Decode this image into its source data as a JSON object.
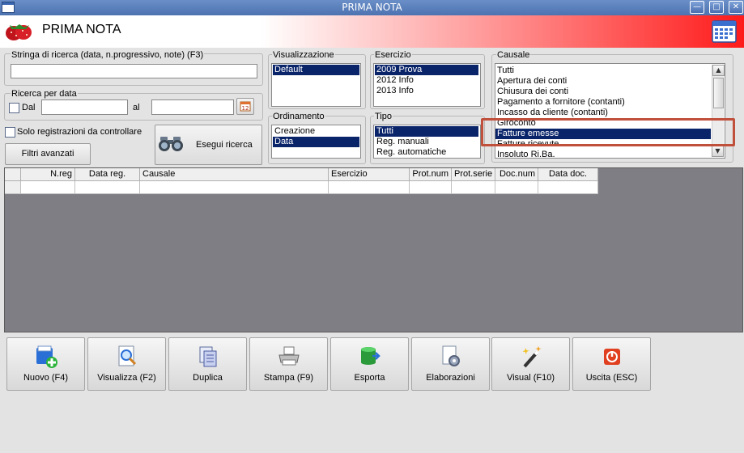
{
  "window": {
    "title": "PRIMA NOTA"
  },
  "header": {
    "title": "PRIMA NOTA"
  },
  "search": {
    "label": "Stringa di ricerca (data, n.progressivo, note) (F3)",
    "value": ""
  },
  "date_search": {
    "label": "Ricerca per data",
    "from_label": "Dal",
    "to_label": "al",
    "from_value": "",
    "to_value": ""
  },
  "options": {
    "only_to_check_label": "Solo registrazioni da controllare",
    "advanced_filters_label": "Filtri avanzati",
    "run_search_label": "Esegui ricerca"
  },
  "visualizzazione": {
    "label": "Visualizzazione",
    "items": [
      "Default"
    ]
  },
  "esercizio": {
    "label": "Esercizio",
    "items": [
      "2009 Prova",
      "2012 Info",
      "2013 Info"
    ]
  },
  "ordinamento": {
    "label": "Ordinamento",
    "items": [
      "Creazione",
      "Data"
    ]
  },
  "tipo": {
    "label": "Tipo",
    "items": [
      "Tutti",
      "Reg. manuali",
      "Reg. automatiche"
    ]
  },
  "causale": {
    "label": "Causale",
    "items": [
      "Tutti",
      "Apertura dei conti",
      "Chiusura dei conti",
      "Pagamento a fornitore (contanti)",
      "Incasso da cliente (contanti)",
      "Giroconto",
      "Fatture emesse",
      "Fatture ricevute",
      "Insoluto Ri.Ba."
    ]
  },
  "grid": {
    "columns": [
      "N.reg",
      "Data reg.",
      "Causale",
      "Esercizio",
      "Prot.num",
      "Prot.serie",
      "Doc.num",
      "Data doc."
    ]
  },
  "toolbar": {
    "buttons": [
      "Nuovo (F4)",
      "Visualizza (F2)",
      "Duplica",
      "Stampa (F9)",
      "Esporta",
      "Elaborazioni",
      "Visual (F10)",
      "Uscita (ESC)"
    ]
  },
  "colors": {
    "selection": "#0a246a",
    "highlight_border": "#c0503c",
    "grid_background": "#807e85"
  }
}
